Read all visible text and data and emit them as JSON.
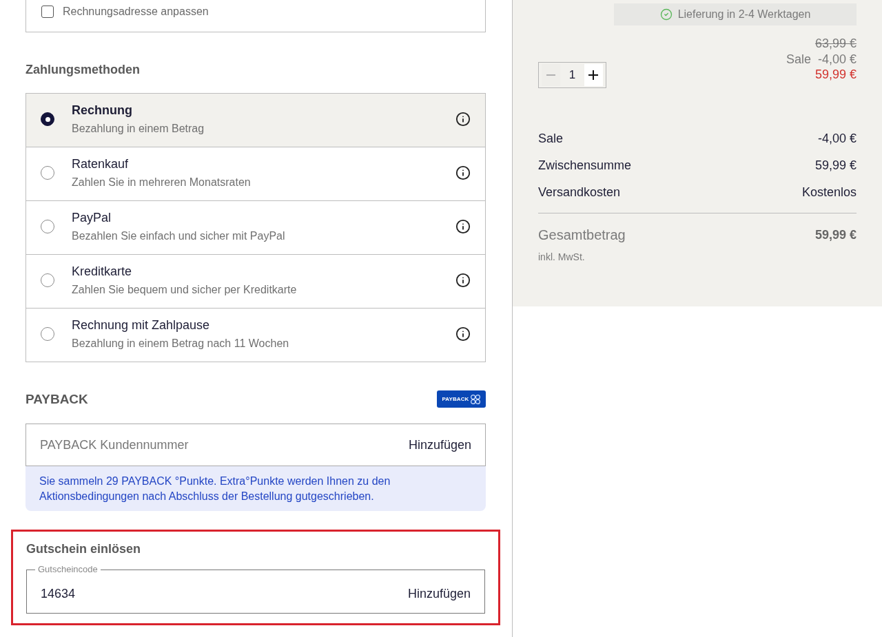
{
  "billing_address_option": {
    "label": "Rechnungsadresse anpassen",
    "checked": false
  },
  "payment": {
    "heading": "Zahlungsmethoden",
    "methods": [
      {
        "title": "Rechnung",
        "description": "Bezahlung in einem Betrag",
        "selected": true
      },
      {
        "title": "Ratenkauf",
        "description": "Zahlen Sie in mehreren Monatsraten",
        "selected": false
      },
      {
        "title": "PayPal",
        "description": "Bezahlen Sie einfach und sicher mit PayPal",
        "selected": false
      },
      {
        "title": "Kreditkarte",
        "description": "Zahlen Sie bequem und sicher per Kreditkarte",
        "selected": false
      },
      {
        "title": "Rechnung mit Zahlpause",
        "description": "Bezahlung in einem Betrag nach 11 Wochen",
        "selected": false
      }
    ]
  },
  "payback": {
    "heading": "PAYBACK",
    "logo_text": "PAYBACK",
    "field": {
      "placeholder": "PAYBACK Kundennummer",
      "button": "Hinzufügen"
    },
    "note": "Sie sammeln 29 PAYBACK °Punkte. Extra°Punkte werden Ihnen zu den Aktionsbedingungen nach Abschluss der Bestellung gutgeschrieben."
  },
  "voucher": {
    "highlighted": true,
    "heading": "Gutschein einlösen",
    "field": {
      "label": "Gutscheincode",
      "value": "14634",
      "button": "Hinzufügen"
    }
  },
  "cart": {
    "delivery": "Lieferung in 2-4 Werktagen",
    "original_price": "63,99 €",
    "discount_label": "Sale",
    "discount": "-4,00 €",
    "price": "59,99 €",
    "quantity": "1",
    "decrease_disabled": true
  },
  "summary": {
    "rows": [
      {
        "label": "Sale",
        "value": "-4,00 €"
      },
      {
        "label": "Zwischensumme",
        "value": "59,99 €"
      },
      {
        "label": "Versandkosten",
        "value": "Kostenlos"
      }
    ],
    "total_label": "Gesamtbetrag",
    "total_value": "59,99 €",
    "tax_note": "inkl. MwSt."
  }
}
